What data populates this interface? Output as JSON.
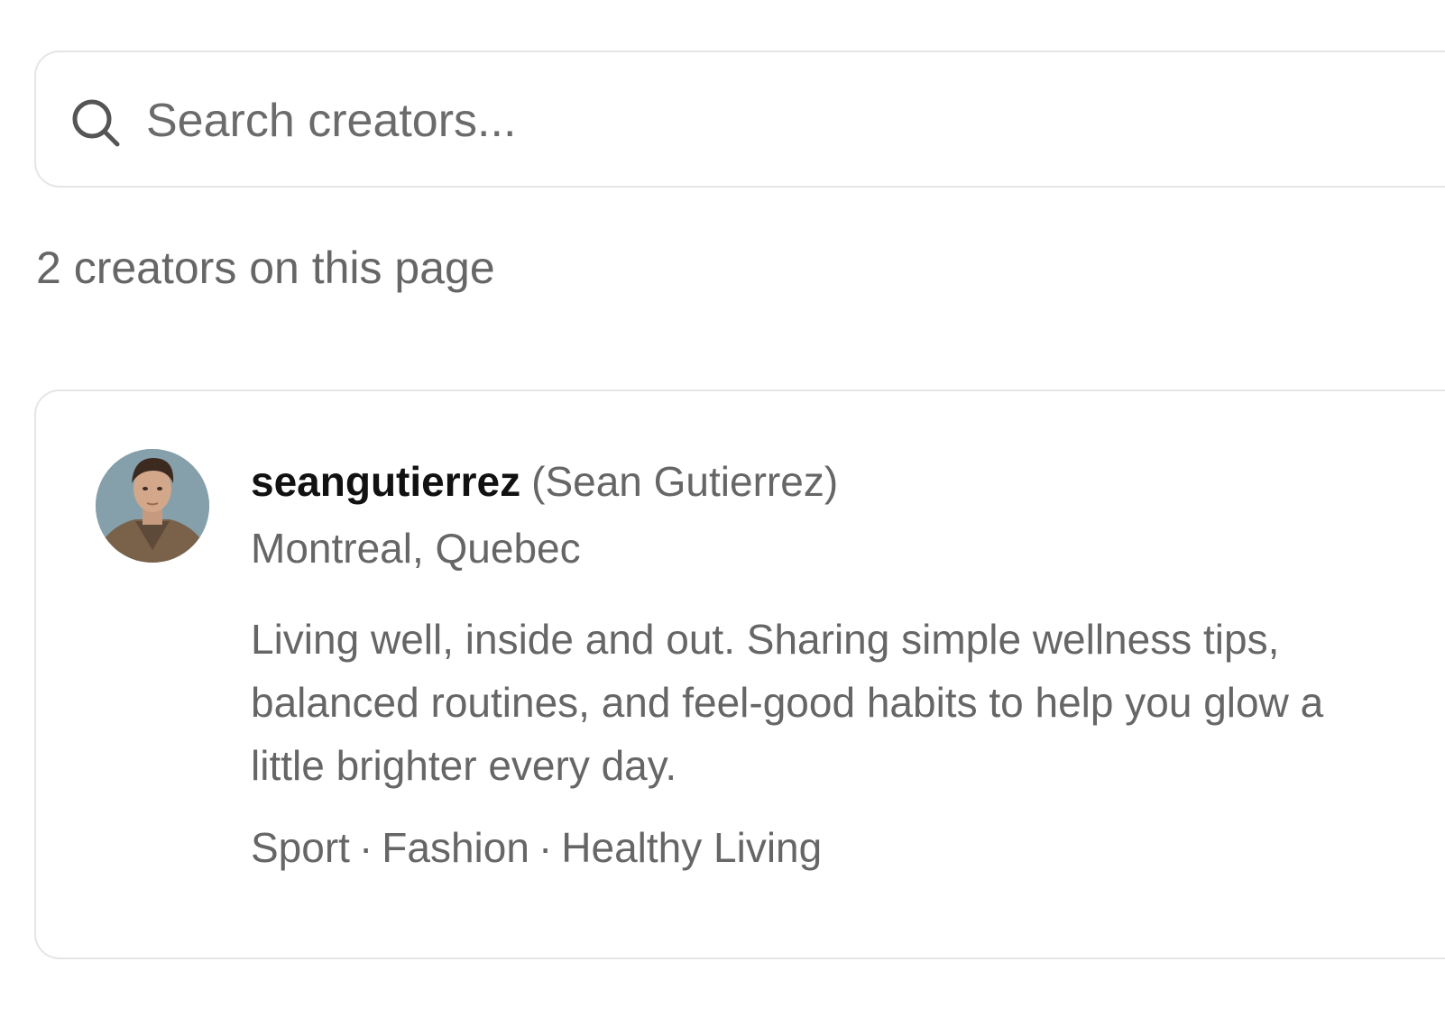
{
  "search": {
    "placeholder": "Search creators...",
    "value": ""
  },
  "results": {
    "count_text": "2 creators on this page"
  },
  "creators": [
    {
      "username": "seangutierrez",
      "display_name": "(Sean Gutierrez)",
      "location": "Montreal, Quebec",
      "bio": "Living well, inside and out. Sharing simple wellness tips, balanced routines, and feel-good habits to help you glow a little brighter every day.",
      "tags": [
        "Sport",
        "Fashion",
        "Healthy Living"
      ],
      "tag_separator": "·",
      "avatar_icon": "profile-photo"
    }
  ],
  "colors": {
    "border": "#e5e5e5",
    "muted_text": "#666666",
    "primary_text": "#111111"
  }
}
